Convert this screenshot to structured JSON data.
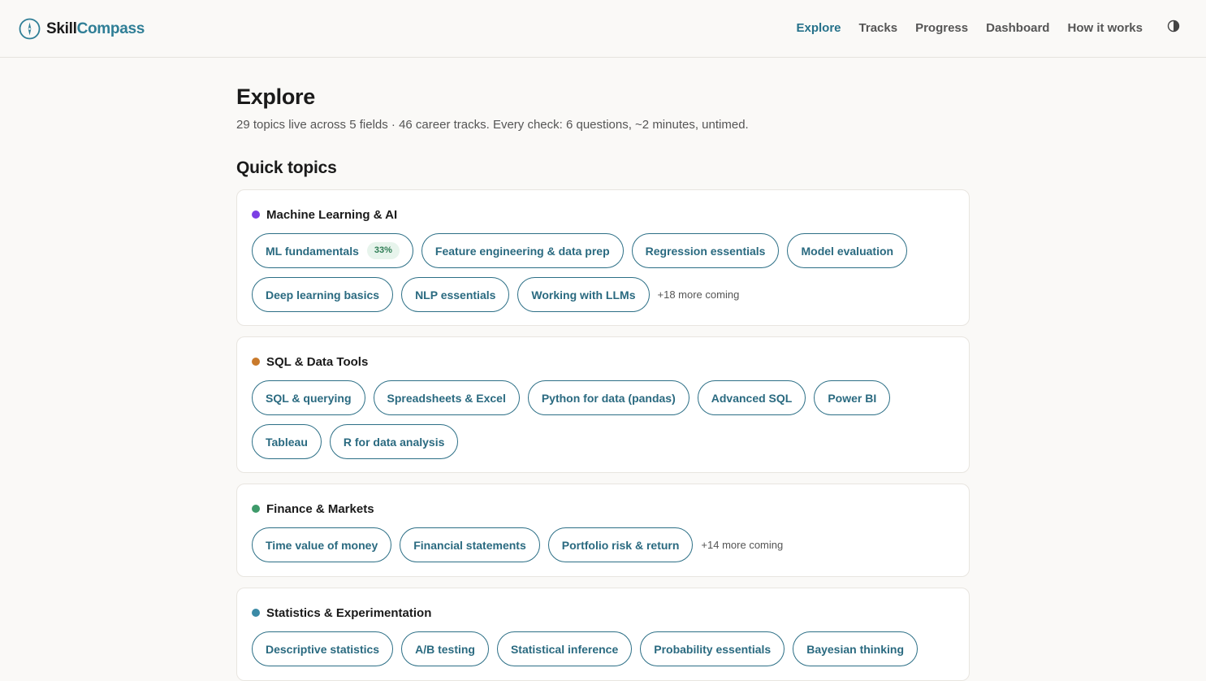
{
  "brand": {
    "name_part1": "Skill",
    "name_part2": "Compass",
    "icon": "compass-icon"
  },
  "nav": {
    "items": [
      {
        "label": "Explore",
        "active": true
      },
      {
        "label": "Tracks",
        "active": false
      },
      {
        "label": "Progress",
        "active": false
      },
      {
        "label": "Dashboard",
        "active": false
      },
      {
        "label": "How it works",
        "active": false
      }
    ],
    "theme_toggle_icon": "contrast-icon"
  },
  "page": {
    "title": "Explore",
    "subtitle": "29 topics live across 5 fields · 46 career tracks. Every check: 6 questions, ~2 minutes, untimed.",
    "section_title": "Quick topics"
  },
  "colors": {
    "accent": "#2c6f86",
    "ml": "#7b3fe4",
    "sql": "#c97a2c",
    "finance": "#3e9a6a",
    "stats": "#3b8aa6"
  },
  "fields": [
    {
      "name": "Machine Learning & AI",
      "topics": [
        {
          "label": "ML fundamentals",
          "badge": "33%"
        },
        {
          "label": "Feature engineering & data prep"
        },
        {
          "label": "Regression essentials"
        },
        {
          "label": "Model evaluation"
        },
        {
          "label": "Deep learning basics"
        },
        {
          "label": "NLP essentials"
        },
        {
          "label": "Working with LLMs"
        }
      ],
      "more": "+18 more coming"
    },
    {
      "name": "SQL & Data Tools",
      "topics": [
        {
          "label": "SQL & querying"
        },
        {
          "label": "Spreadsheets & Excel"
        },
        {
          "label": "Python for data (pandas)"
        },
        {
          "label": "Advanced SQL"
        },
        {
          "label": "Power BI"
        },
        {
          "label": "Tableau"
        },
        {
          "label": "R for data analysis"
        }
      ]
    },
    {
      "name": "Finance & Markets",
      "topics": [
        {
          "label": "Time value of money"
        },
        {
          "label": "Financial statements"
        },
        {
          "label": "Portfolio risk & return"
        }
      ],
      "more": "+14 more coming"
    },
    {
      "name": "Statistics & Experimentation",
      "topics": [
        {
          "label": "Descriptive statistics"
        },
        {
          "label": "A/B testing"
        },
        {
          "label": "Statistical inference"
        },
        {
          "label": "Probability essentials"
        },
        {
          "label": "Bayesian thinking"
        }
      ]
    }
  ]
}
